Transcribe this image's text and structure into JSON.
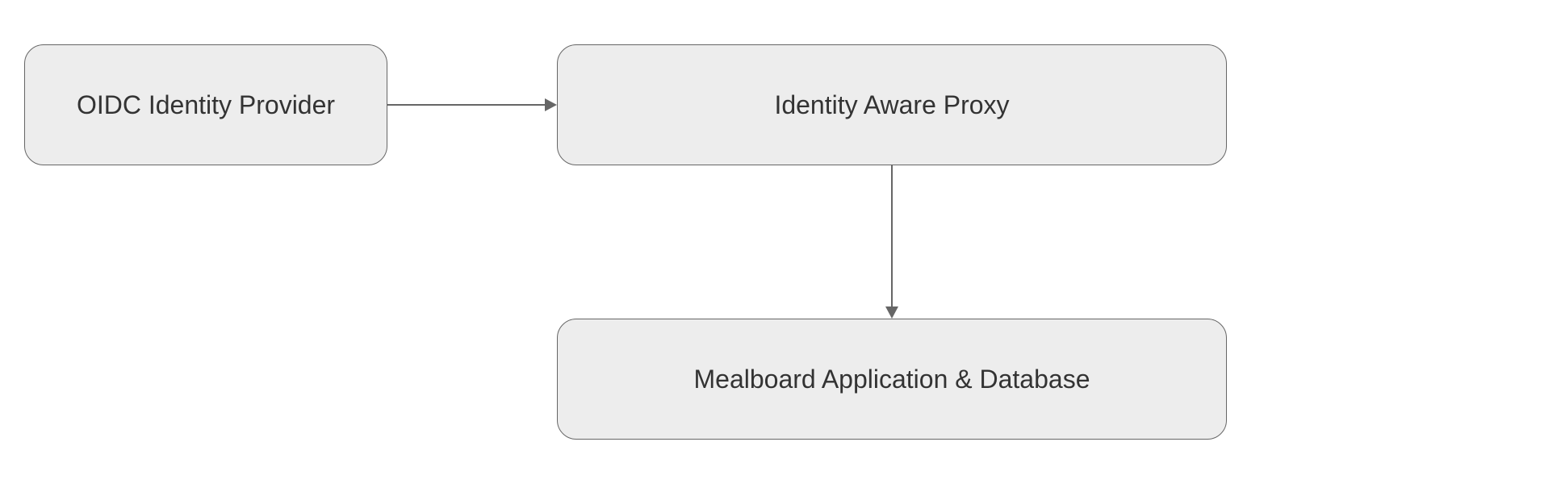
{
  "nodes": {
    "oidc": {
      "label": "OIDC Identity Provider"
    },
    "proxy": {
      "label": "Identity Aware Proxy"
    },
    "app": {
      "label": "Mealboard Application & Database"
    }
  }
}
